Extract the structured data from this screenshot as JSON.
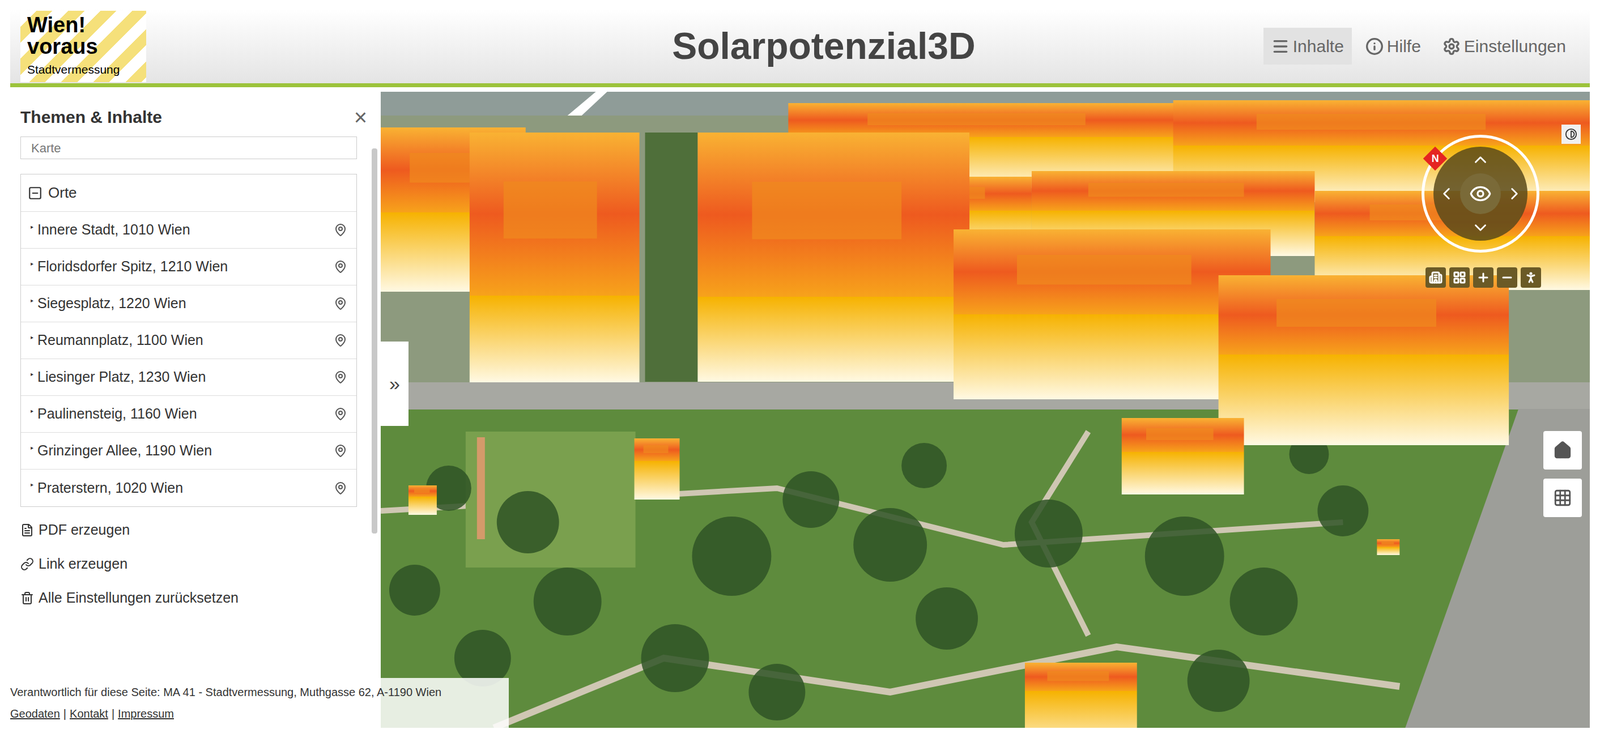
{
  "header": {
    "logo": {
      "line1": "Wien!",
      "line2": "voraus",
      "line3": "Stadtvermessung"
    },
    "title": "Solarpotenzial3D",
    "nav": [
      {
        "label": "Inhalte",
        "selected": true
      },
      {
        "label": "Hilfe",
        "selected": false
      },
      {
        "label": "Einstellungen",
        "selected": false
      }
    ]
  },
  "sidebar": {
    "title": "Themen & Inhalte",
    "close": "×",
    "field": "Karte",
    "group": {
      "label": "Orte",
      "expanded": true,
      "marker": "‣",
      "items": [
        "Innere Stadt, 1010 Wien",
        "Floridsdorfer Spitz, 1210 Wien",
        "Siegesplatz, 1220 Wien",
        "Reumannplatz, 1100 Wien",
        "Liesinger Platz, 1230 Wien",
        "Paulinensteig, 1160 Wien",
        "Grinzinger Allee, 1190 Wien",
        "Praterstern, 1020 Wien"
      ]
    },
    "actions": [
      "PDF erzeugen",
      "Link erzeugen",
      "Alle Einstellungen zurücksetzen"
    ]
  },
  "map": {
    "collapse": "»",
    "north": "N"
  },
  "footer": {
    "text": "Verantwortlich für diese Seite: MA 41 - Stadtvermessung, Muthgasse 62, A-1190 Wien",
    "links": [
      "Geodaten",
      "Kontakt",
      "Impressum"
    ],
    "separator": "|"
  }
}
